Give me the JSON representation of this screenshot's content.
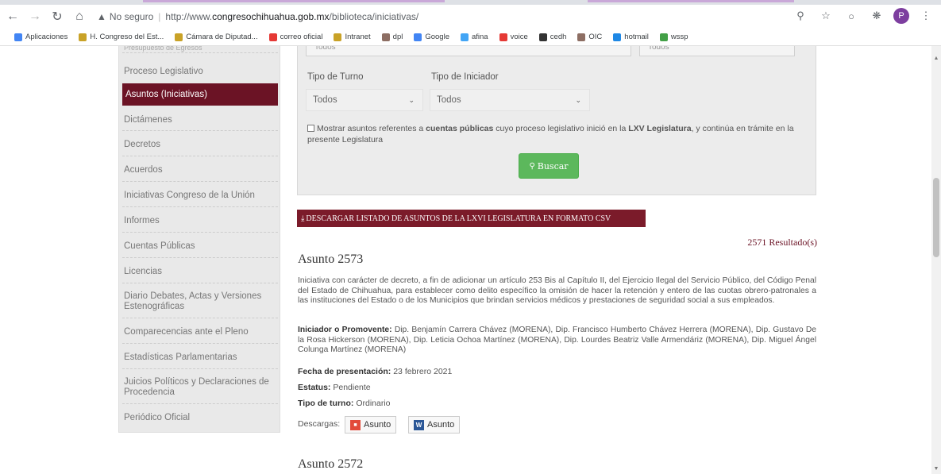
{
  "browser": {
    "insecure_label": "No seguro",
    "url_prefix": "http://www.",
    "url_host": "congresochihuahua.gob.mx",
    "url_path": "/biblioteca/iniciativas/",
    "profile_initial": "P",
    "bookmarks": [
      {
        "label": "Aplicaciones",
        "color": "#4285f4"
      },
      {
        "label": "H. Congreso del Est...",
        "color": "#c9a227"
      },
      {
        "label": "Cámara de Diputad...",
        "color": "#c9a227"
      },
      {
        "label": "correo oficial",
        "color": "#e53935"
      },
      {
        "label": "Intranet",
        "color": "#c9a227"
      },
      {
        "label": "dpl",
        "color": "#8d6e63"
      },
      {
        "label": "Google",
        "color": "#4285f4"
      },
      {
        "label": "afina",
        "color": "#42a5f5"
      },
      {
        "label": "voice",
        "color": "#e53935"
      },
      {
        "label": "cedh",
        "color": "#333333"
      },
      {
        "label": "OIC",
        "color": "#8d6e63"
      },
      {
        "label": "hotmail",
        "color": "#1e88e5"
      },
      {
        "label": "wssp",
        "color": "#43a047"
      }
    ]
  },
  "sidebar": {
    "items": [
      "Proceso Legislativo",
      "Asuntos (Iniciativas)",
      "Dictámenes",
      "Decretos",
      "Acuerdos",
      "Iniciativas Congreso de la Unión",
      "Informes",
      "Cuentas Públicas",
      "Licencias",
      "Diario Debates, Actas y Versiones Estenográficas",
      "Comparecencias ante el Pleno",
      "Estadísticas Parlamentarias",
      "Juicios Políticos y Declaraciones de Procedencia",
      "Periódico Oficial"
    ]
  },
  "filters": {
    "top_select_a": "Todos",
    "top_select_b": "Todos",
    "tipo_turno_label": "Tipo de Turno",
    "tipo_turno_value": "Todos",
    "tipo_iniciador_label": "Tipo de Iniciador",
    "tipo_iniciador_value": "Todos",
    "checkbox_text_1": "Mostrar asuntos referentes a ",
    "checkbox_bold_1": "cuentas públicas",
    "checkbox_text_2": " cuyo proceso legislativo inició en la ",
    "checkbox_bold_2": "LXV Legislatura",
    "checkbox_text_3": ", y continúa en trámite en la presente Legislatura",
    "search_label": "Buscar"
  },
  "csv_button": "DESCARGAR LISTADO DE ASUNTOS DE LA LXVI LEGISLATURA EN FORMATO CSV",
  "results_count": "2571 Resultado(s)",
  "asuntos": [
    {
      "title": "Asunto 2573",
      "description": "Iniciativa con carácter de decreto, a fin de adicionar un artículo 253 Bis al Capítulo II, del Ejercicio Ilegal del Servicio Público, del Código Penal del Estado de Chihuahua, para establecer como delito específico la omisión de hacer la retención y entero de las cuotas obrero-patronales a las instituciones del Estado o de los Municipios que brindan servicios médicos y prestaciones de seguridad social a sus empleados.",
      "iniciador_label": "Iniciador o Promovente:",
      "iniciador": "Dip. Benjamín Carrera Chávez (MORENA), Dip. Francisco Humberto Chávez Herrera (MORENA), Dip. Gustavo De la Rosa Hickerson (MORENA), Dip. Leticia Ochoa Martínez (MORENA), Dip. Lourdes Beatriz Valle Armendáriz (MORENA), Dip. Miguel Ángel Colunga Martínez (MORENA)",
      "fecha_label": "Fecha de presentación:",
      "fecha": "23 febrero 2021",
      "estatus_label": "Estatus:",
      "estatus": "Pendiente",
      "turno_label": "Tipo de turno:",
      "turno": "Ordinario",
      "descargas_label": "Descargas:",
      "pdf_label": "Asunto",
      "word_label": "Asunto"
    },
    {
      "title": "Asunto 2572"
    }
  ]
}
